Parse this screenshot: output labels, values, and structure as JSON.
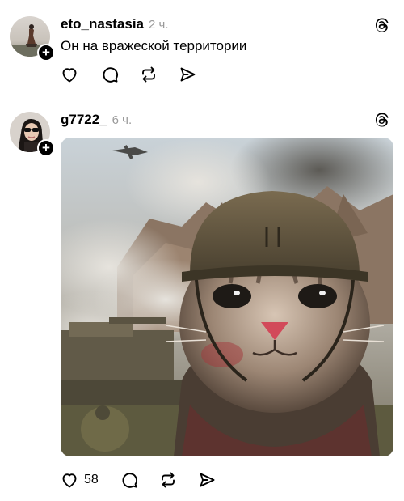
{
  "posts": [
    {
      "username": "eto_nastasia",
      "time": "2 ч.",
      "text": "Он на вражеской территории",
      "like_count": ""
    },
    {
      "username": "g7722_",
      "time": "6 ч.",
      "text": "",
      "like_count": "58"
    }
  ],
  "icons": {
    "like": "heart-icon",
    "comment": "comment-icon",
    "repost": "repost-icon",
    "share": "send-icon",
    "threads": "threads-logo-icon",
    "follow": "plus-icon"
  }
}
